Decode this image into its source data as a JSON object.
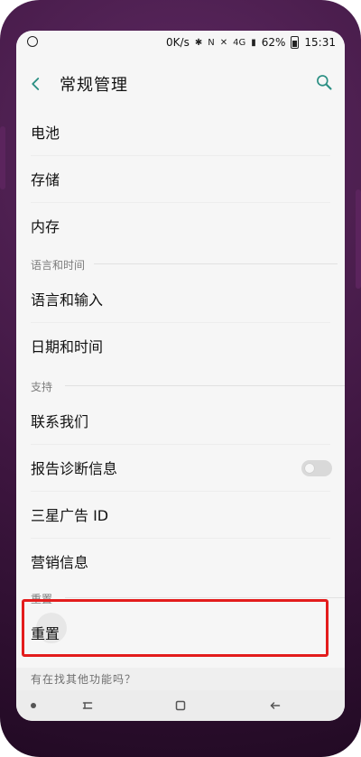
{
  "status_bar": {
    "speed": "0K/s",
    "network": "4G",
    "battery": "62%",
    "time": "15:31"
  },
  "header": {
    "title": "常规管理"
  },
  "sections": {
    "lang_time": "语言和时间",
    "support": "支持",
    "reset": "重置"
  },
  "items": {
    "battery": "电池",
    "storage": "存储",
    "memory": "内存",
    "lang_input": "语言和输入",
    "date_time": "日期和时间",
    "contact_us": "联系我们",
    "report_diag": "报告诊断信息",
    "samsung_ad_id": "三星广告 ID",
    "marketing": "营销信息",
    "reset": "重置"
  },
  "partial_text": "有在找其他功能吗？",
  "colors": {
    "accent": "#2b8f83",
    "highlight": "#e31c1c",
    "phone": "#4a1a4d"
  },
  "toggles": {
    "report_diag_enabled": false
  }
}
